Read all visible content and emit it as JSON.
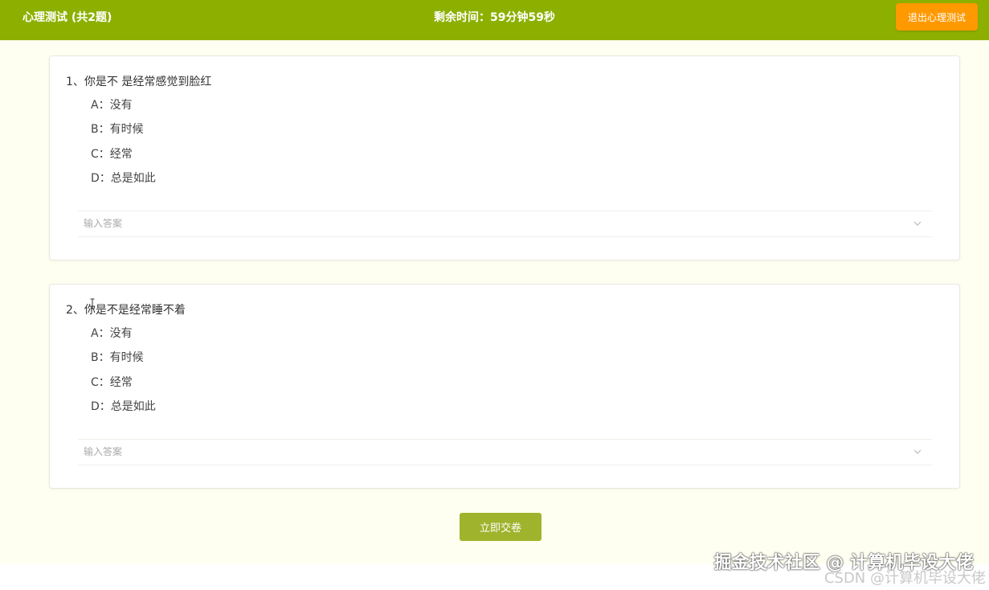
{
  "header": {
    "title": "心理测试 (共2题)",
    "timer": "剩余时间：59分钟59秒",
    "exit_label": "退出心理测试"
  },
  "questions": [
    {
      "title": "1、你是不 是经常感觉到脸红",
      "options": [
        "A：没有",
        "B：有时候",
        "C：经常",
        "D：总是如此"
      ],
      "answer_placeholder": "输入答案"
    },
    {
      "title": "2、你是不是经常睡不着",
      "options": [
        "A：没有",
        "B：有时候",
        "C：经常",
        "D：总是如此"
      ],
      "answer_placeholder": "输入答案"
    }
  ],
  "submit_label": "立即交卷",
  "watermarks": {
    "primary": "掘金技术社区 @ 计算机毕设大佬",
    "secondary": "CSDN @计算机毕设大佬"
  },
  "colors": {
    "header_bg": "#8db000",
    "exit_button": "#ff9900",
    "submit_button": "#9fb42c",
    "page_bg": "#fffff1"
  },
  "icons": {
    "answer_dropdown": "chevron-down-icon",
    "text_cursor": "text-cursor-icon"
  }
}
